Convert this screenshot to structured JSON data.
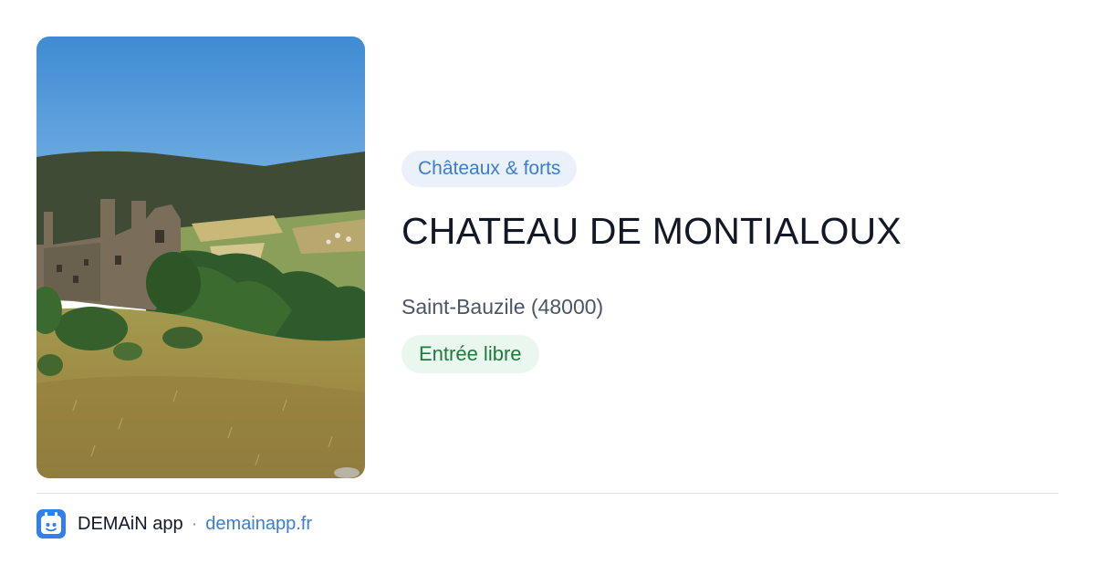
{
  "place": {
    "category": "Châteaux & forts",
    "name": "CHATEAU DE MONTIALOUX",
    "location": "Saint-Bauzile (48000)",
    "price": "Entrée libre",
    "photo": "castle-ruin-hillside-photo"
  },
  "footer": {
    "app_name": "DEMAiN app",
    "separator": "·",
    "site": "demainapp.fr",
    "logo_icon": "demain-app-logo-icon"
  },
  "colors": {
    "category_bg": "#eaf1fb",
    "category_text": "#3b7dd0",
    "price_bg": "#e9f7ee",
    "price_text": "#1e7b3c",
    "title_text": "#121826",
    "link": "#3b7dd0"
  }
}
